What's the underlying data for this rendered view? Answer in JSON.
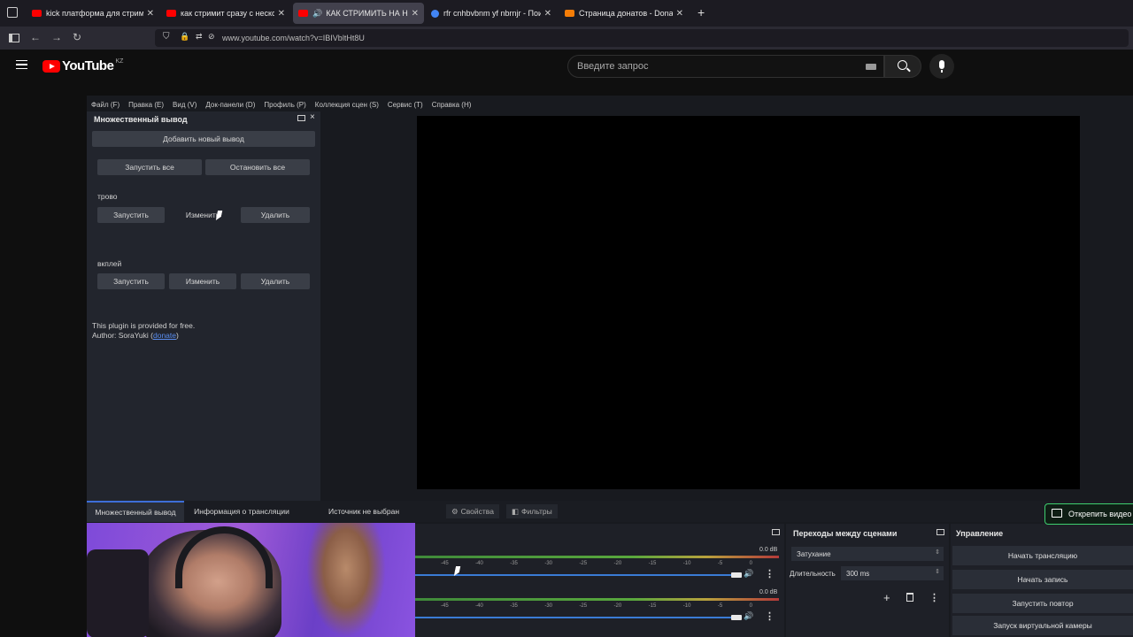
{
  "browser": {
    "tabs": [
      {
        "label": "kick платформа для стримов -",
        "favicon_color": "#ff0000",
        "active": false
      },
      {
        "label": "как стримит сразу с нескольк",
        "favicon_color": "#ff0000",
        "active": false
      },
      {
        "label": "КАК СТРИМИТЬ НА НЕСК",
        "favicon_color": "#ff0000",
        "active": true
      },
      {
        "label": "rfr cnhbvbnm yf nbrnjr - Поиск",
        "favicon_color": "#4285f4",
        "active": false
      },
      {
        "label": "Страница донатов - Donation",
        "favicon_color": "#f57d07",
        "active": false
      }
    ],
    "new_tab": "+",
    "url": "www.youtube.com/watch?v=IBIVbltHt8U"
  },
  "youtube": {
    "logo_text": "YouTube",
    "country": "KZ",
    "search_placeholder": "Введите запрос"
  },
  "obs": {
    "menu": [
      "Файл (F)",
      "Правка (E)",
      "Вид (V)",
      "Док-панели (D)",
      "Профиль (P)",
      "Коллекция сцен (S)",
      "Сервис (T)",
      "Справка (H)"
    ],
    "multi_output": {
      "title": "Множественный вывод",
      "add_button": "Добавить новый вывод",
      "start_all": "Запустить все",
      "stop_all": "Остановить все",
      "outputs": [
        {
          "name": "трово",
          "start": "Запустить",
          "edit": "Изменить",
          "delete": "Удалить"
        },
        {
          "name": "вкплей",
          "start": "Запустить",
          "edit": "Изменить",
          "delete": "Удалить"
        }
      ],
      "footer_line1": "This plugin is provided for free.",
      "footer_line2_prefix": "Author: SoraYuki (",
      "footer_link": "donate",
      "footer_line2_suffix": ")"
    },
    "bottom_tabs": [
      "Множественный вывод",
      "Информация о трансляции"
    ],
    "source_status": "Источник не выбран",
    "properties_button": "Свойства",
    "filters_button": "Фильтры",
    "mixer": {
      "tracks": [
        {
          "db": "0.0 dB",
          "ticks": [
            "-45",
            "-40",
            "-35",
            "-30",
            "-25",
            "-20",
            "-15",
            "-10",
            "-5",
            "0"
          ]
        },
        {
          "db": "0.0 dB",
          "ticks": [
            "-45",
            "-40",
            "-35",
            "-30",
            "-25",
            "-20",
            "-15",
            "-10",
            "-5",
            "0"
          ]
        }
      ]
    },
    "transitions": {
      "title": "Переходы между сценами",
      "selected": "Затухание",
      "duration_label": "Длительность",
      "duration_value": "300 ms"
    },
    "controls": {
      "title": "Управление",
      "buttons": [
        "Начать трансляцию",
        "Начать запись",
        "Запустить повтор",
        "Запуск виртуальной камеры"
      ]
    }
  },
  "overlay": {
    "unpin_label": "Открепить видео"
  },
  "colors": {
    "yt_red": "#ff0000",
    "accent_blue": "#3d6ed8",
    "unpin_border": "#3ecf6f"
  }
}
